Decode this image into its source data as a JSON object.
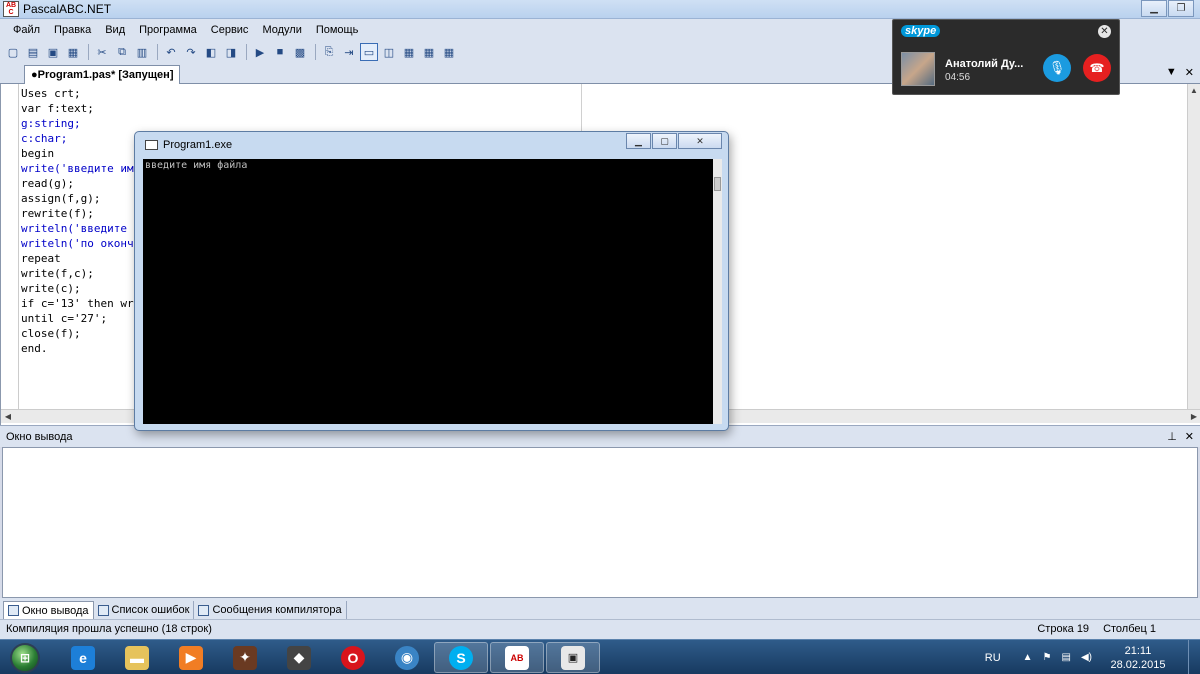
{
  "window": {
    "title": "PascalABC.NET"
  },
  "menu": [
    "Файл",
    "Правка",
    "Вид",
    "Программа",
    "Сервис",
    "Модули",
    "Помощь"
  ],
  "tab": {
    "label": "●Program1.pas* [Запущен]"
  },
  "code_lines": [
    "Uses crt;",
    "var f:text;",
    "g:string;",
    "c:char;",
    "begin",
    "write('введите им",
    "read(g);",
    "assign(f,g);",
    "rewrite(f);",
    "writeln('введите ",
    "writeln('по оконч",
    "repeat",
    "write(f,c);",
    "write(c);",
    "if c='13' then wr",
    "until c='27';",
    "close(f);",
    "end."
  ],
  "console": {
    "title": "Program1.exe",
    "output": "введите имя файла"
  },
  "output_panel": {
    "title": "Окно вывода"
  },
  "bottom_tabs": [
    "Окно вывода",
    "Список ошибок",
    "Сообщения компилятора"
  ],
  "status": {
    "message": "Компиляция прошла успешно (18 строк)",
    "row_label": "Строка",
    "row": "19",
    "col_label": "Столбец",
    "col": "1"
  },
  "skype": {
    "brand": "skype",
    "contact": "Анатолий Ду...",
    "duration": "04:56"
  },
  "taskbar": {
    "lang": "RU",
    "time": "21:11",
    "date": "28.02.2015"
  },
  "colors": {
    "string_literal": "#0000c8",
    "skype_mic": "#1b9be0",
    "skype_hangup": "#e62020"
  }
}
